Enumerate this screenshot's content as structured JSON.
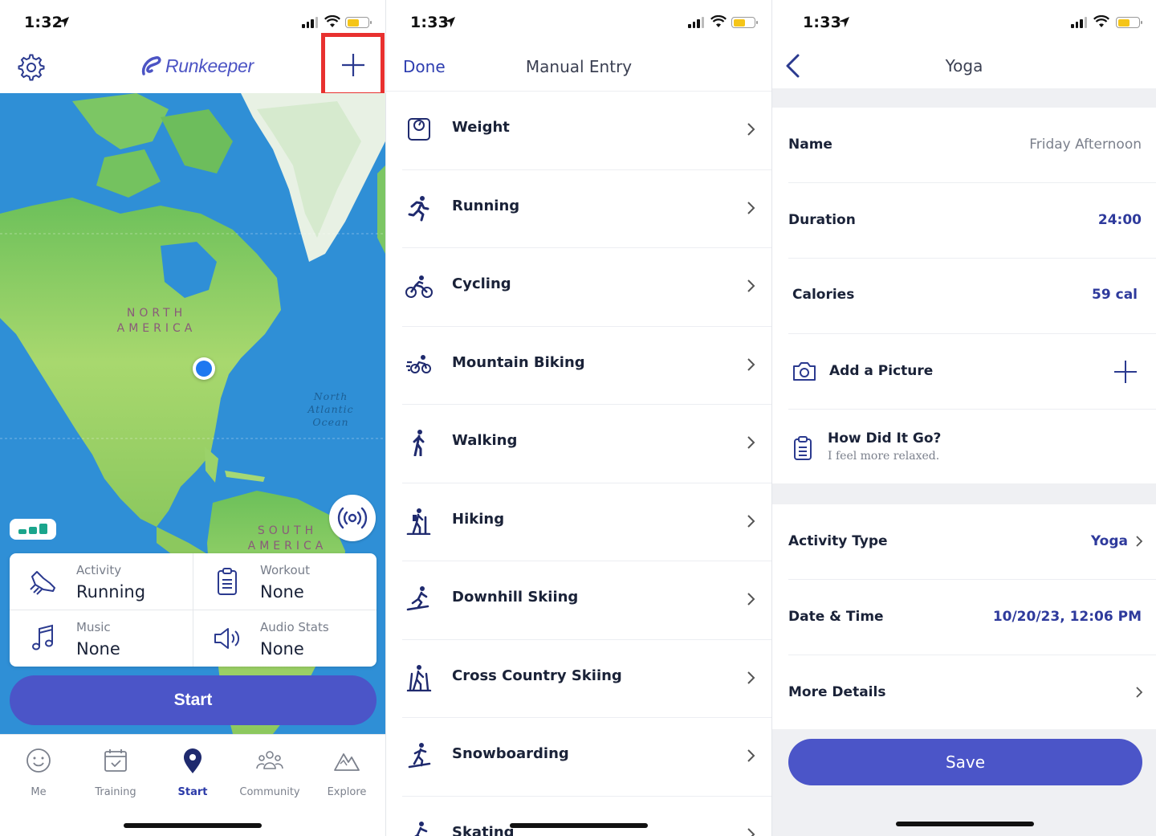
{
  "screen1": {
    "status": {
      "time": "1:32"
    },
    "brand": "Runkeeper",
    "map": {
      "north_america": "NORTH AMERICA",
      "south_america": "SOUTH AMERICA",
      "ocean": "North Atlantic Ocean"
    },
    "cards": [
      {
        "label": "Activity",
        "value": "Running",
        "icon": "running-shoe-icon"
      },
      {
        "label": "Workout",
        "value": "None",
        "icon": "clipboard-icon"
      },
      {
        "label": "Music",
        "value": "None",
        "icon": "music-note-icon"
      },
      {
        "label": "Audio Stats",
        "value": "None",
        "icon": "speaker-icon"
      }
    ],
    "start_label": "Start",
    "tabs": [
      {
        "label": "Me",
        "icon": "smiley-icon"
      },
      {
        "label": "Training",
        "icon": "calendar-icon"
      },
      {
        "label": "Start",
        "icon": "map-pin-icon",
        "active": true
      },
      {
        "label": "Community",
        "icon": "people-icon"
      },
      {
        "label": "Explore",
        "icon": "mountain-icon"
      }
    ]
  },
  "screen2": {
    "status": {
      "time": "1:33"
    },
    "done_label": "Done",
    "title": "Manual Entry",
    "items": [
      {
        "label": "Weight",
        "icon": "scale-icon"
      },
      {
        "label": "Running",
        "icon": "runner-icon"
      },
      {
        "label": "Cycling",
        "icon": "cyclist-icon"
      },
      {
        "label": "Mountain Biking",
        "icon": "mountain-bike-icon"
      },
      {
        "label": "Walking",
        "icon": "walker-icon"
      },
      {
        "label": "Hiking",
        "icon": "hiker-icon"
      },
      {
        "label": "Downhill Skiing",
        "icon": "skier-icon"
      },
      {
        "label": "Cross Country Skiing",
        "icon": "cross-country-skier-icon"
      },
      {
        "label": "Snowboarding",
        "icon": "snowboarder-icon"
      },
      {
        "label": "Skating",
        "icon": "skater-icon"
      }
    ]
  },
  "screen3": {
    "status": {
      "time": "1:33"
    },
    "title": "Yoga",
    "name": {
      "label": "Name",
      "value": "Friday Afternoon"
    },
    "duration": {
      "label": "Duration",
      "value": "24:00"
    },
    "calories": {
      "label": "Calories",
      "value": "59 cal"
    },
    "picture": {
      "label": "Add a Picture"
    },
    "how": {
      "label": "How Did It Go?",
      "value": "I feel more relaxed."
    },
    "activity_type": {
      "label": "Activity Type",
      "value": "Yoga"
    },
    "date_time": {
      "label": "Date & Time",
      "value": "10/20/23, 12:06 PM"
    },
    "more_details": {
      "label": "More Details"
    },
    "save_label": "Save"
  },
  "colors": {
    "accent": "#4b55c8",
    "link": "#2e3eb0",
    "highlight_box": "#e8312f",
    "map_ocean": "#2f8fd6",
    "map_land": "#8fd06a"
  }
}
